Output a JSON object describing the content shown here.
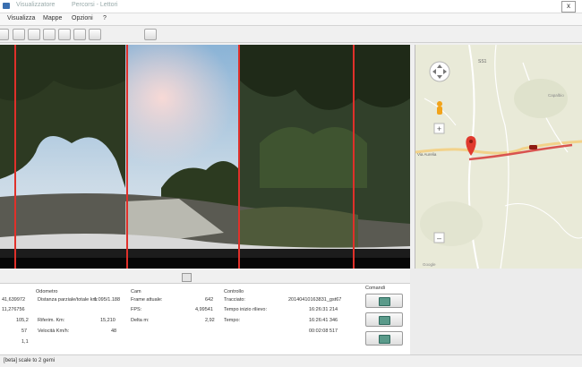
{
  "window": {
    "title": "Visualizzatore",
    "subtitle": "Percorsi - Lettori",
    "close_label": "x"
  },
  "menu": {
    "items": [
      "Visualizza",
      "Mappe",
      "Opzioni",
      "?"
    ]
  },
  "toolbar": {
    "buttons": [
      "toolbar-button-1",
      "toolbar-button-2",
      "toolbar-button-3",
      "toolbar-button-4",
      "toolbar-button-5",
      "toolbar-button-6",
      "toolbar-button-7",
      "toolbar-button-8"
    ]
  },
  "panel": {
    "headers": {
      "odometro": "Odometro",
      "cam": "Cam",
      "controllo": "Controllo",
      "comandi": "Comandi"
    },
    "left_values": [
      "41,639972",
      "11,276756",
      "105,2",
      "57",
      "1,1"
    ],
    "odometro_labels": [
      "Distanza parziale/totale km:",
      "Riferim. Km:",
      "Velocità Km/h:"
    ],
    "odometro_values": [
      "1.095/1.188",
      "15,210",
      "48"
    ],
    "cam_labels": [
      "Frame attuale:",
      "FPS:",
      "Delta m:"
    ],
    "cam_values": [
      "642",
      "4,99541",
      "2,92"
    ],
    "controllo_labels": [
      "Tracciato:",
      "Tempo inizio rilievo:",
      "Tempo:"
    ],
    "controllo_values": [
      "20140410163831_gst67",
      "16:26:31 214",
      "16:26:41 346",
      "00:02:08 517"
    ]
  },
  "status": {
    "text": "[beta] scale to 2 gemi"
  },
  "map": {
    "labels": [
      "SS1",
      "Via Aurelia",
      "Capalbio"
    ],
    "footer": "Google"
  },
  "colors": {
    "pano_divider": "#e0302a",
    "route": "#d9534f",
    "marker": "#e03a2e",
    "pegman": "#f2a31a"
  },
  "icons": {
    "map_pan": "pan-control-icon",
    "map_zoom_in": "zoom-in-icon",
    "map_zoom_out": "zoom-out-icon",
    "pegman": "pegman-icon",
    "marker": "location-marker-icon",
    "car": "car-icon",
    "play": "play-icon",
    "forward": "forward-icon",
    "stop": "stop-icon"
  }
}
